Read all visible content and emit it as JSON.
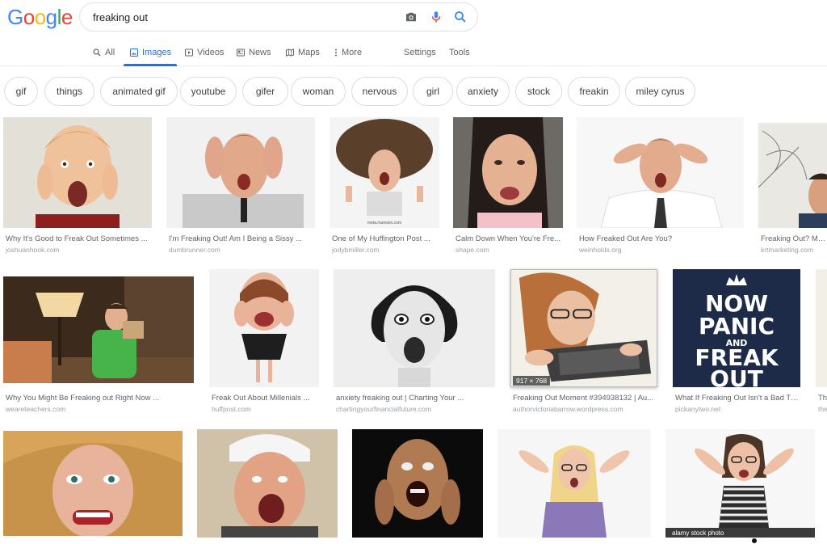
{
  "logo": {
    "letters": [
      "G",
      "o",
      "o",
      "g",
      "l",
      "e"
    ],
    "colors": [
      "#4285f4",
      "#ea4335",
      "#fbbc05",
      "#4285f4",
      "#34a853",
      "#ea4335"
    ]
  },
  "search": {
    "query": "freaking out"
  },
  "tabs": [
    {
      "label": "All",
      "icon": "search-icon",
      "active": false
    },
    {
      "label": "Images",
      "icon": "image-icon",
      "active": true
    },
    {
      "label": "Videos",
      "icon": "play-icon",
      "active": false
    },
    {
      "label": "News",
      "icon": "newspaper-icon",
      "active": false
    },
    {
      "label": "Maps",
      "icon": "map-icon",
      "active": false
    },
    {
      "label": "More",
      "icon": "more-vert-icon",
      "active": false
    }
  ],
  "tools": {
    "settings": "Settings",
    "tools": "Tools"
  },
  "chips": [
    "gif",
    "things",
    "animated gif",
    "youtube",
    "gifer",
    "woman",
    "nervous",
    "girl",
    "anxiety",
    "stock",
    "freakin",
    "miley cyrus"
  ],
  "results": {
    "row1": [
      {
        "caption": "Why It's Good to Freak Out Sometimes ...",
        "domain": "joshuanhook.com"
      },
      {
        "caption": "I'm Freaking Out! Am I Being a Sissy ...",
        "domain": "dumbrunner.com"
      },
      {
        "caption": "One of My Huffington Post ...",
        "domain": "jodybmiller.com",
        "watermark": "meta.mansion.com"
      },
      {
        "caption": "Calm Down When You're Fre...",
        "domain": "shape.com"
      },
      {
        "caption": "How Freaked Out Are You?",
        "domain": "weinholds.org"
      },
      {
        "caption": "Freaking Out? Mana",
        "domain": "krtmarketing.com"
      }
    ],
    "row2": [
      {
        "caption": "Why You Might Be Freaking out Right Now ...",
        "domain": "weareteachers.com"
      },
      {
        "caption": "Freak Out About Millenials ...",
        "domain": "huffpost.com"
      },
      {
        "caption": "anxiety freaking out | Charting Your ...",
        "domain": "chartingyourfinancialfuture.com"
      },
      {
        "caption": "Freaking Out Moment #394938132 | Au...",
        "domain": "authorvictoriabarrow.wordpress.com",
        "dims": "917 × 768"
      },
      {
        "caption": "What If Freaking Out Isn't a Bad Th...",
        "domain": "pickanytwo.net",
        "poster": [
          "NOW",
          "PANIC",
          "AND",
          "FREAK",
          "OUT"
        ]
      },
      {
        "caption": "Th",
        "domain": "the"
      }
    ],
    "row3": [
      {
        "caption": "",
        "domain": ""
      },
      {
        "caption": "",
        "domain": ""
      },
      {
        "caption": "",
        "domain": ""
      },
      {
        "caption": "",
        "domain": ""
      },
      {
        "caption": "",
        "domain": "",
        "badge": "alamy stock photo"
      }
    ]
  }
}
